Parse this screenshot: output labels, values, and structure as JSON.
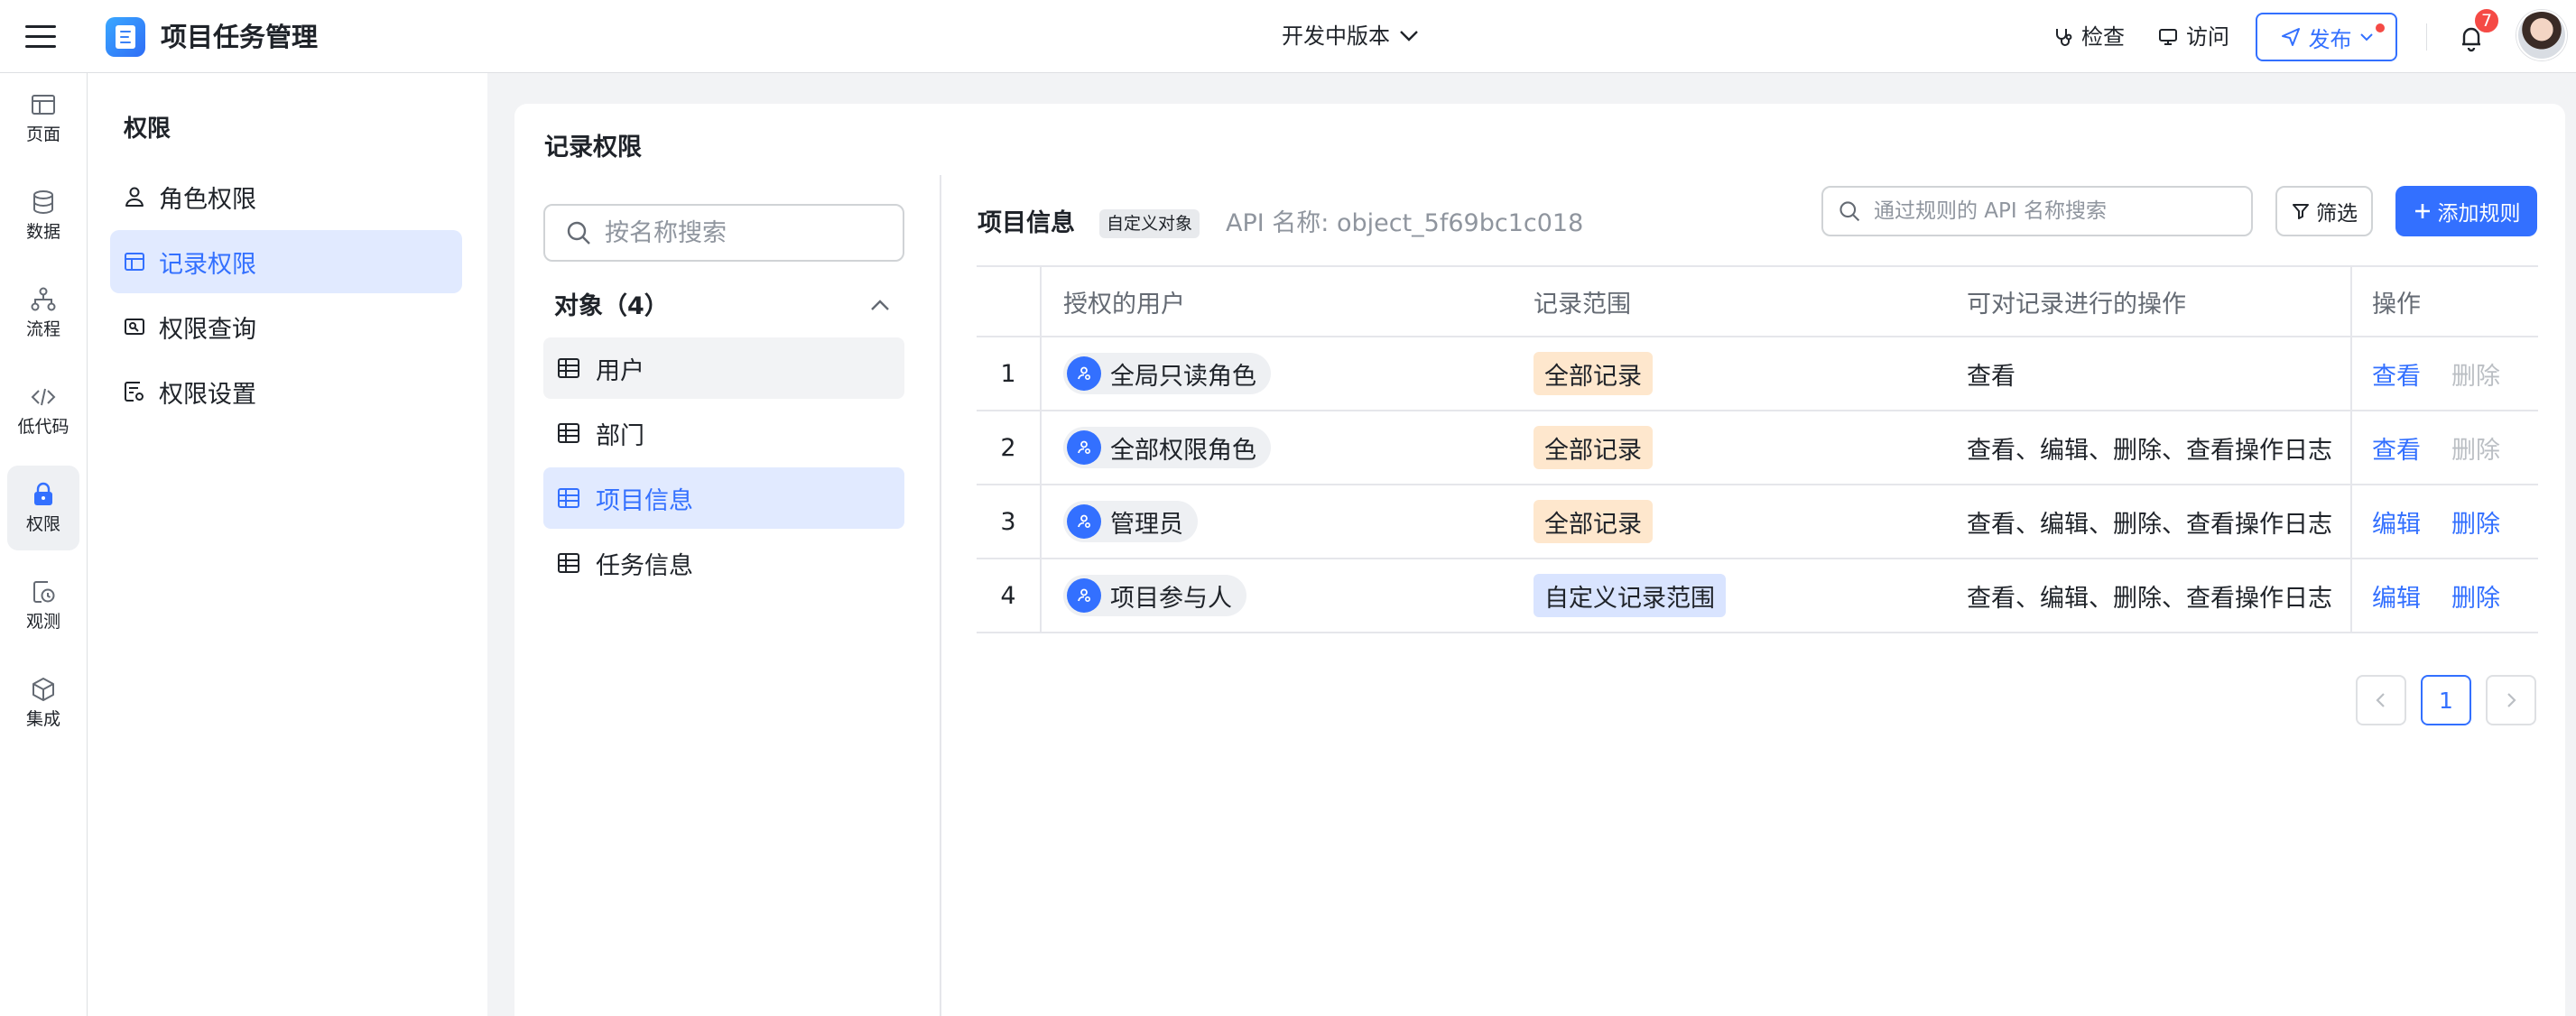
{
  "app": {
    "title": "项目任务管理",
    "version_label": "开发中版本"
  },
  "topbar": {
    "check_label": "检查",
    "visit_label": "访问",
    "publish_label": "发布",
    "notification_count": "7"
  },
  "rail": [
    {
      "label": "页面",
      "icon": "layout-icon"
    },
    {
      "label": "数据",
      "icon": "database-icon"
    },
    {
      "label": "流程",
      "icon": "workflow-icon"
    },
    {
      "label": "低代码",
      "icon": "code-icon"
    },
    {
      "label": "权限",
      "icon": "lock-icon",
      "active": true
    },
    {
      "label": "观测",
      "icon": "monitor-icon"
    },
    {
      "label": "集成",
      "icon": "integration-icon"
    }
  ],
  "perm_menu": {
    "title": "权限",
    "items": [
      {
        "label": "角色权限",
        "icon": "user-icon"
      },
      {
        "label": "记录权限",
        "icon": "table-icon",
        "active": true
      },
      {
        "label": "权限查询",
        "icon": "search-user-icon"
      },
      {
        "label": "权限设置",
        "icon": "settings-doc-icon"
      }
    ]
  },
  "record_perm": {
    "title": "记录权限",
    "search_placeholder": "按名称搜索",
    "objects_header": "对象（4）",
    "objects": [
      {
        "label": "用户"
      },
      {
        "label": "部门"
      },
      {
        "label": "项目信息",
        "active": true
      },
      {
        "label": "任务信息"
      }
    ]
  },
  "detail": {
    "object_name": "项目信息",
    "object_tag": "自定义对象",
    "api_name": "API 名称: object_5f69bc1c018",
    "rule_search_placeholder": "通过规则的 API 名称搜索",
    "filter_label": "筛选",
    "add_rule_label": "添加规则",
    "columns": {
      "user": "授权的用户",
      "scope": "记录范围",
      "ops": "可对记录进行的操作",
      "action": "操作"
    },
    "rows": [
      {
        "index": "1",
        "user": "全局只读角色",
        "scope": "全部记录",
        "scope_color": "#fee7cd",
        "ops": "查看",
        "action1": "查看",
        "action2": "删除",
        "action2_disabled": true
      },
      {
        "index": "2",
        "user": "全部权限角色",
        "scope": "全部记录",
        "scope_color": "#fee7cd",
        "ops": "查看、编辑、删除、查看操作日志",
        "action1": "查看",
        "action2": "删除",
        "action2_disabled": true
      },
      {
        "index": "3",
        "user": "管理员",
        "scope": "全部记录",
        "scope_color": "#fee7cd",
        "ops": "查看、编辑、删除、查看操作日志",
        "action1": "编辑",
        "action2": "删除",
        "action2_disabled": false
      },
      {
        "index": "4",
        "user": "项目参与人",
        "scope": "自定义记录范围",
        "scope_color": "#d9e4ff",
        "ops": "查看、编辑、删除、查看操作日志",
        "action1": "编辑",
        "action2": "删除",
        "action2_disabled": false
      }
    ],
    "pagination": {
      "current_page": "1"
    }
  },
  "colors": {
    "accent": "#3370ff",
    "badge": "#f54a45",
    "active_bg": "#e1eaff"
  }
}
